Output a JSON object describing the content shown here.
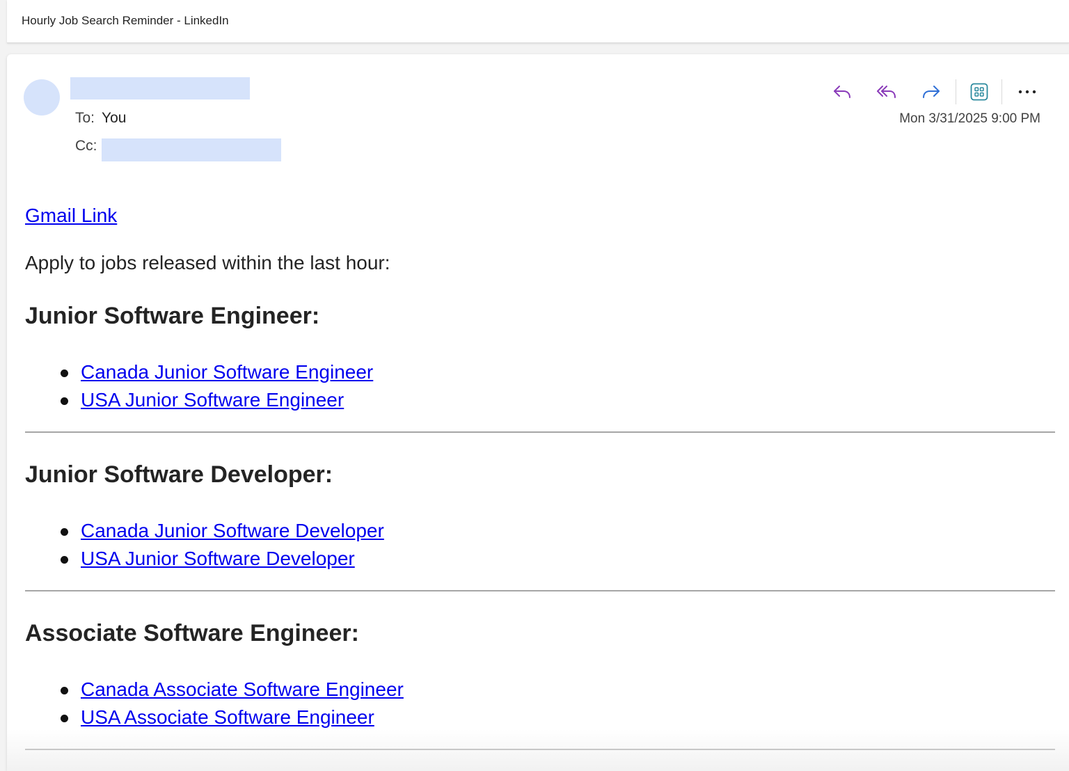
{
  "window": {
    "title": "Hourly Job Search Reminder - LinkedIn"
  },
  "message": {
    "to_label": "To:",
    "to_value": "You",
    "cc_label": "Cc:",
    "date": "Mon 3/31/2025 9:00 PM"
  },
  "actions": {
    "reply": "reply-icon",
    "reply_all": "reply-all-icon",
    "forward": "forward-icon",
    "apps": "apps-grid-icon",
    "more": "more-icon",
    "colors": {
      "reply": "#8a3ab9",
      "forward": "#2f6fd6",
      "apps": "#2b8a9e"
    }
  },
  "body": {
    "gmail_link": "Gmail Link",
    "intro": "Apply to jobs released within the last hour:",
    "sections": [
      {
        "heading": "Junior Software Engineer:",
        "links": [
          "Canada Junior Software Engineer",
          "USA Junior Software Engineer"
        ]
      },
      {
        "heading": "Junior Software Developer:",
        "links": [
          "Canada Junior Software Developer",
          "USA Junior Software Developer"
        ]
      },
      {
        "heading": "Associate Software Engineer:",
        "links": [
          "Canada Associate Software Engineer",
          "USA Associate Software Engineer"
        ]
      }
    ]
  }
}
